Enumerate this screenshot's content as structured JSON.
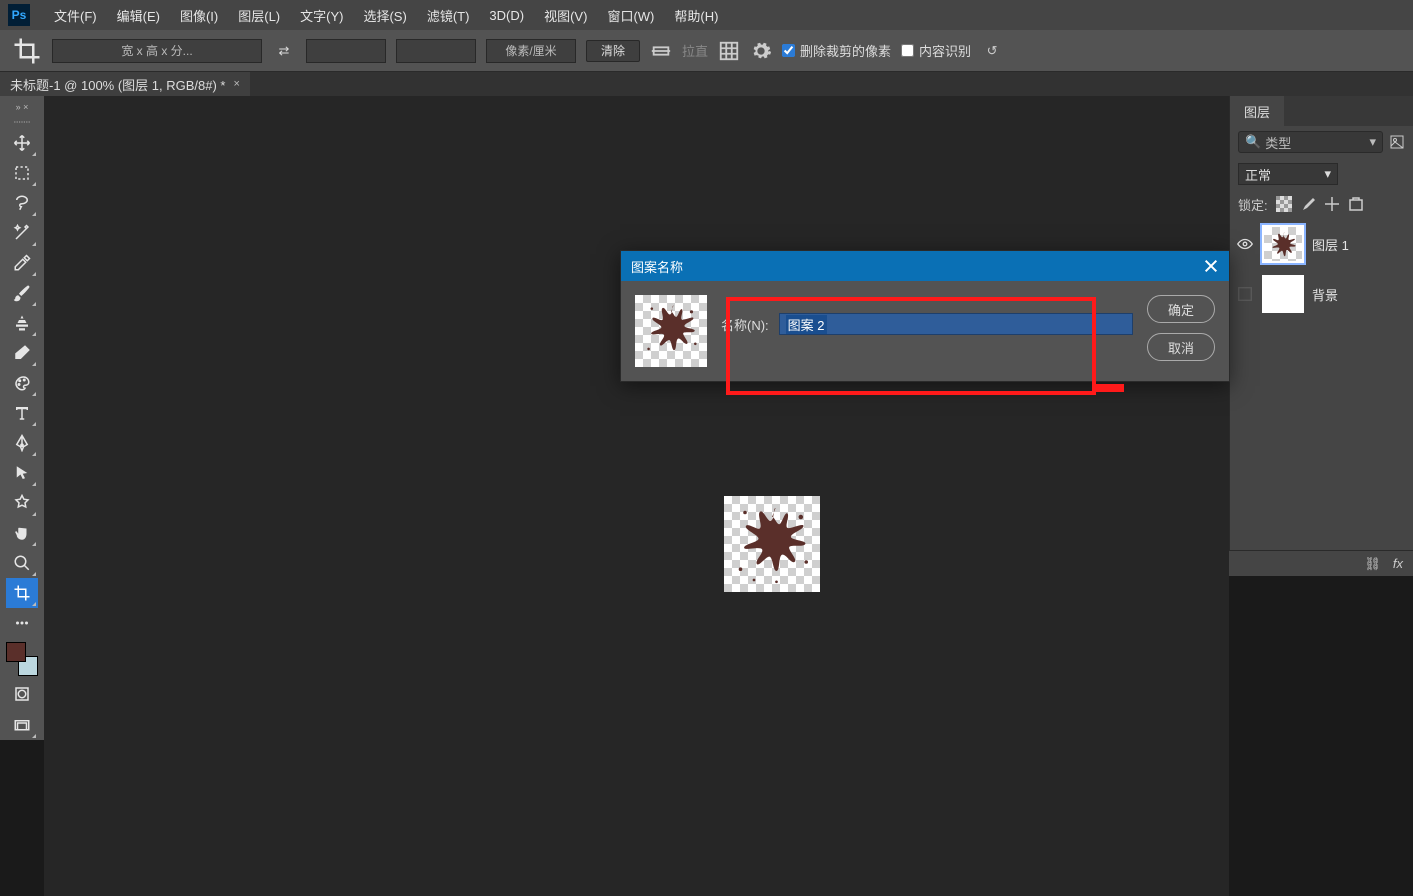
{
  "menubar": {
    "items": [
      "文件(F)",
      "编辑(E)",
      "图像(I)",
      "图层(L)",
      "文字(Y)",
      "选择(S)",
      "滤镜(T)",
      "3D(D)",
      "视图(V)",
      "窗口(W)",
      "帮助(H)"
    ]
  },
  "optionsbar": {
    "ratio_placeholder": "宽 x 高 x 分...",
    "unit_label": "像素/厘米",
    "clear_btn": "清除",
    "straighten_label": "拉直",
    "delete_crop": "删除裁剪的像素",
    "content_aware": "内容识别"
  },
  "doctab": {
    "title": "未标题-1 @ 100% (图层 1, RGB/8#) *"
  },
  "layers_panel": {
    "tab": "图层",
    "filter_placeholder": "类型",
    "blend_mode": "正常",
    "lock_label": "锁定:",
    "layer1": "图层 1",
    "layer_bg": "背景"
  },
  "dialog": {
    "title": "图案名称",
    "name_label": "名称(N):",
    "input_value": "图案 2",
    "ok": "确定",
    "cancel": "取消"
  },
  "colors": {
    "foreground": "#5a2f2a",
    "accent": "#0a70b5"
  }
}
